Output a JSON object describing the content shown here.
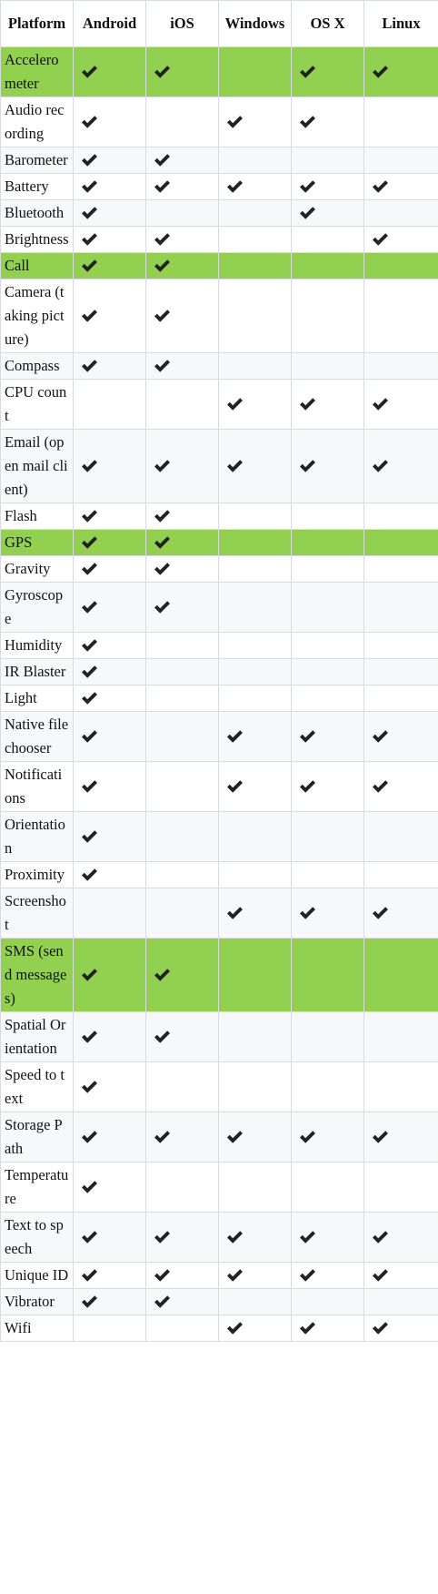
{
  "colors": {
    "highlight": "#92d050",
    "stripe": "#f7f8f9",
    "border": "#d9dcdf",
    "check": "#222222"
  },
  "icons": {
    "supported": "check-icon"
  },
  "headers": [
    "Platform",
    "Android",
    "iOS",
    "Windows",
    "OS X",
    "Linux"
  ],
  "rows": [
    {
      "feature": "Accelerometer",
      "support": [
        1,
        1,
        0,
        1,
        1
      ],
      "highlight": true
    },
    {
      "feature": "Audio recording",
      "support": [
        1,
        0,
        1,
        1,
        0
      ],
      "highlight": false
    },
    {
      "feature": "Barometer",
      "support": [
        1,
        1,
        0,
        0,
        0
      ],
      "highlight": false
    },
    {
      "feature": "Battery",
      "support": [
        1,
        1,
        1,
        1,
        1
      ],
      "highlight": false
    },
    {
      "feature": "Bluetooth",
      "support": [
        1,
        0,
        0,
        1,
        0
      ],
      "highlight": false
    },
    {
      "feature": "Brightness",
      "support": [
        1,
        1,
        0,
        0,
        1
      ],
      "highlight": false
    },
    {
      "feature": "Call",
      "support": [
        1,
        1,
        0,
        0,
        0
      ],
      "highlight": true
    },
    {
      "feature": "Camera (taking picture)",
      "support": [
        1,
        1,
        0,
        0,
        0
      ],
      "highlight": false
    },
    {
      "feature": "Compass",
      "support": [
        1,
        1,
        0,
        0,
        0
      ],
      "highlight": false
    },
    {
      "feature": "CPU count",
      "support": [
        0,
        0,
        1,
        1,
        1
      ],
      "highlight": false
    },
    {
      "feature": "Email (open mail client)",
      "support": [
        1,
        1,
        1,
        1,
        1
      ],
      "highlight": false
    },
    {
      "feature": "Flash",
      "support": [
        1,
        1,
        0,
        0,
        0
      ],
      "highlight": false
    },
    {
      "feature": "GPS",
      "support": [
        1,
        1,
        0,
        0,
        0
      ],
      "highlight": true
    },
    {
      "feature": "Gravity",
      "support": [
        1,
        1,
        0,
        0,
        0
      ],
      "highlight": false
    },
    {
      "feature": "Gyroscope",
      "support": [
        1,
        1,
        0,
        0,
        0
      ],
      "highlight": false
    },
    {
      "feature": "Humidity",
      "support": [
        1,
        0,
        0,
        0,
        0
      ],
      "highlight": false
    },
    {
      "feature": "IR Blaster",
      "support": [
        1,
        0,
        0,
        0,
        0
      ],
      "highlight": false
    },
    {
      "feature": "Light",
      "support": [
        1,
        0,
        0,
        0,
        0
      ],
      "highlight": false
    },
    {
      "feature": "Native file chooser",
      "support": [
        1,
        0,
        1,
        1,
        1
      ],
      "highlight": false
    },
    {
      "feature": "Notifications",
      "support": [
        1,
        0,
        1,
        1,
        1
      ],
      "highlight": false
    },
    {
      "feature": "Orientation",
      "support": [
        1,
        0,
        0,
        0,
        0
      ],
      "highlight": false
    },
    {
      "feature": "Proximity",
      "support": [
        1,
        0,
        0,
        0,
        0
      ],
      "highlight": false
    },
    {
      "feature": "Screenshot",
      "support": [
        0,
        0,
        1,
        1,
        1
      ],
      "highlight": false
    },
    {
      "feature": "SMS (send messages)",
      "support": [
        1,
        1,
        0,
        0,
        0
      ],
      "highlight": true
    },
    {
      "feature": "Spatial Orientation",
      "support": [
        1,
        1,
        0,
        0,
        0
      ],
      "highlight": false
    },
    {
      "feature": "Speed to text",
      "support": [
        1,
        0,
        0,
        0,
        0
      ],
      "highlight": false
    },
    {
      "feature": "Storage Path",
      "support": [
        1,
        1,
        1,
        1,
        1
      ],
      "highlight": false
    },
    {
      "feature": "Temperature",
      "support": [
        1,
        0,
        0,
        0,
        0
      ],
      "highlight": false
    },
    {
      "feature": "Text to speech",
      "support": [
        1,
        1,
        1,
        1,
        1
      ],
      "highlight": false
    },
    {
      "feature": "Unique ID",
      "support": [
        1,
        1,
        1,
        1,
        1
      ],
      "highlight": false
    },
    {
      "feature": "Vibrator",
      "support": [
        1,
        1,
        0,
        0,
        0
      ],
      "highlight": false
    },
    {
      "feature": "Wifi",
      "support": [
        0,
        0,
        1,
        1,
        1
      ],
      "highlight": false
    }
  ]
}
